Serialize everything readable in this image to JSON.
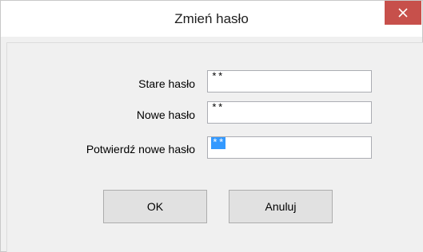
{
  "window": {
    "title": "Zmień hasło",
    "close_icon": "close-icon",
    "close_color": "#c7504b"
  },
  "form": {
    "old_password_label": "Stare hasło",
    "old_password_value": "**",
    "new_password_label": "Nowe hasło",
    "new_password_value": "**",
    "confirm_password_label": "Potwierdź nowe hasło",
    "confirm_password_value": "**",
    "confirm_selected": true
  },
  "buttons": {
    "ok_label": "OK",
    "cancel_label": "Anuluj"
  }
}
